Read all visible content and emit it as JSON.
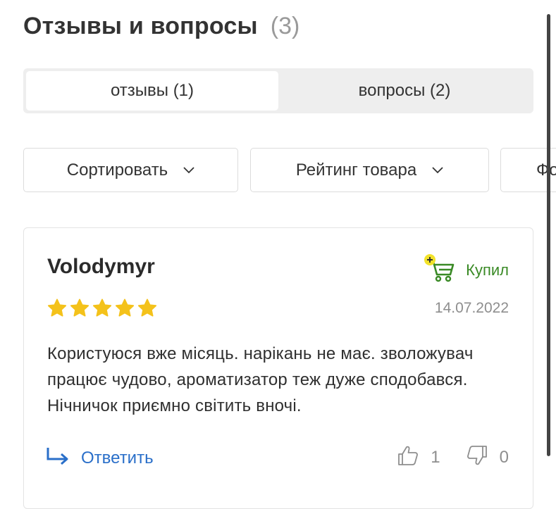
{
  "header": {
    "title": "Отзывы и вопросы",
    "count": "(3)"
  },
  "tabs": [
    {
      "label": "отзывы (1)",
      "active": true
    },
    {
      "label": "вопросы (2)",
      "active": false
    }
  ],
  "filters": [
    {
      "label": "Сортировать"
    },
    {
      "label": "Рейтинг товара"
    },
    {
      "label": "Фо"
    }
  ],
  "review": {
    "author": "Volodymyr",
    "bought_label": "Купил",
    "rating": 5,
    "rating_max": 5,
    "date": "14.07.2022",
    "text": "Користуюся вже місяць. нарікань не має. зволожувач працює чудово, ароматизатор теж дуже сподобався. Нічничок приємно світить вночі.",
    "reply_label": "Ответить",
    "likes": "1",
    "dislikes": "0"
  },
  "colors": {
    "accent_blue": "#2a6fc9",
    "bought_green": "#3a8a26",
    "star_yellow": "#f4c21b",
    "cart_badge_yellow": "#f2e22a"
  },
  "icons": {
    "filter_chevron": "chevron-down-icon",
    "bought": "cart-plus-icon",
    "star": "star-icon",
    "reply": "reply-arrow-icon",
    "like": "thumbs-up-icon",
    "dislike": "thumbs-down-icon"
  }
}
